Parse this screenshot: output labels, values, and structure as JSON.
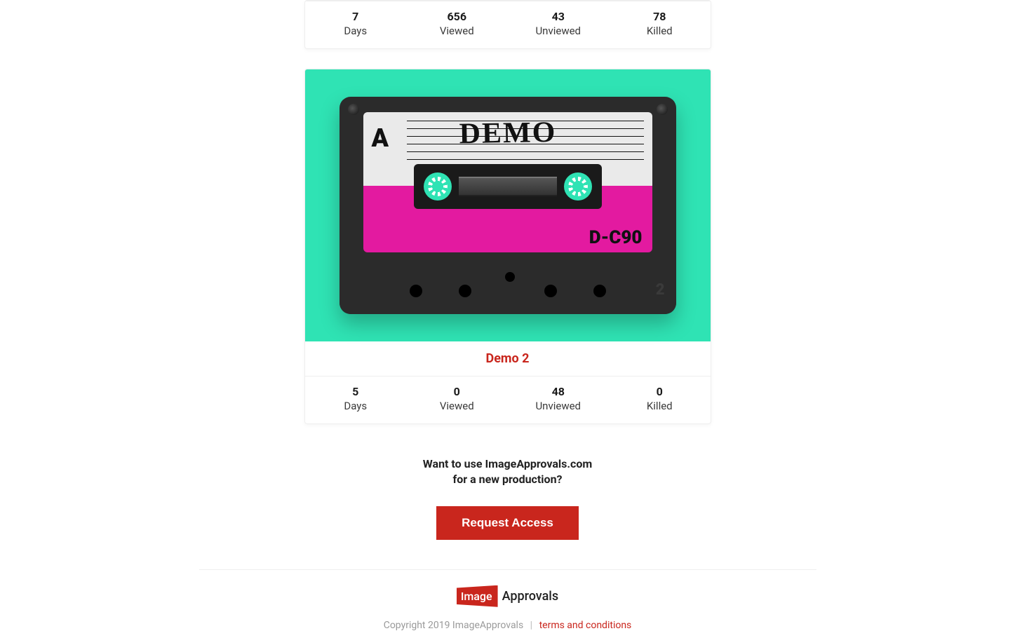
{
  "cards": [
    {
      "title": "",
      "stats": {
        "days": {
          "value": "7",
          "label": "Days"
        },
        "viewed": {
          "value": "656",
          "label": "Viewed"
        },
        "unviewed": {
          "value": "43",
          "label": "Unviewed"
        },
        "killed": {
          "value": "78",
          "label": "Killed"
        }
      }
    },
    {
      "title": "Demo 2",
      "artwork": {
        "side_letter": "A",
        "handwritten": "DEMO",
        "code": "D-C90",
        "corner_number": "2"
      },
      "stats": {
        "days": {
          "value": "5",
          "label": "Days"
        },
        "viewed": {
          "value": "0",
          "label": "Viewed"
        },
        "unviewed": {
          "value": "48",
          "label": "Unviewed"
        },
        "killed": {
          "value": "0",
          "label": "Killed"
        }
      }
    }
  ],
  "cta": {
    "line1": "Want to use ImageApprovals.com",
    "line2": "for a new production?",
    "button": "Request Access"
  },
  "footer": {
    "logo_badge": "Image",
    "logo_tail": "Approvals",
    "copyright": "Copyright 2019 ImageApprovals",
    "separator": "|",
    "terms": "terms and conditions"
  }
}
